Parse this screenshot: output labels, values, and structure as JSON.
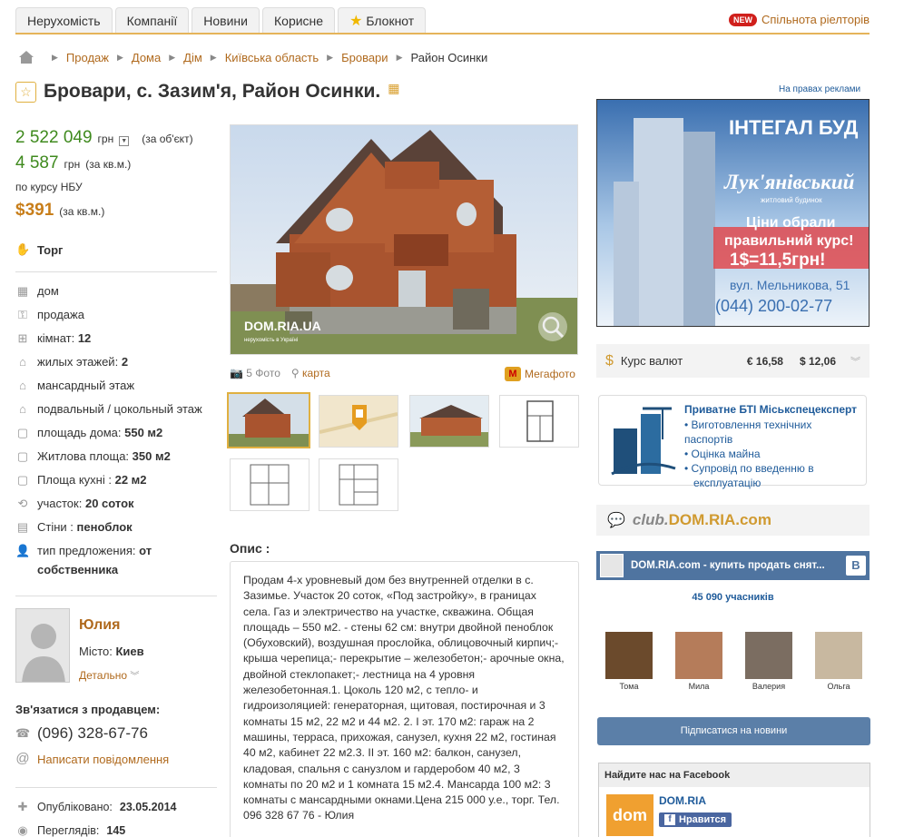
{
  "nav": {
    "tabs": [
      "Нерухомість",
      "Компанії",
      "Новини",
      "Корисне",
      "Блокнот"
    ],
    "new_badge": "NEW",
    "community": "Спільнота ріелторів"
  },
  "breadcrumbs": [
    "Продаж",
    "Дома",
    "Дім",
    "Київська область",
    "Бровари",
    "Район Осинки"
  ],
  "title": "Бровари, с. Зазим'я, Район Осинки.",
  "ad_note": "На правах реклами",
  "price": {
    "total": "2 522 049",
    "total_unit": "грн",
    "total_note": "(за об'єкт)",
    "per_m2": "4 587",
    "per_m2_unit": "грн",
    "per_m2_note": "(за кв.м.)",
    "rate_note": "по курсу НБУ",
    "usd": "$391",
    "usd_note": "(за кв.м.)"
  },
  "bargain": "Торг",
  "params": [
    {
      "icon": "building-icon",
      "label": "дом",
      "value": ""
    },
    {
      "icon": "key-icon",
      "label": "продажа",
      "value": ""
    },
    {
      "icon": "rooms-icon",
      "label": "кімнат:",
      "value": "12"
    },
    {
      "icon": "floors-icon",
      "label": "жилых этажей:",
      "value": "2"
    },
    {
      "icon": "attic-icon",
      "label": "мансардный этаж",
      "value": ""
    },
    {
      "icon": "basement-icon",
      "label": "подвальный / цокольный этаж",
      "value": ""
    },
    {
      "icon": "area-icon",
      "label": "площадь дома:",
      "value": "550 м2"
    },
    {
      "icon": "living-area-icon",
      "label": "Житлова площа:",
      "value": "350 м2"
    },
    {
      "icon": "kitchen-icon",
      "label": "Площа кухні :",
      "value": "22 м2"
    },
    {
      "icon": "plot-icon",
      "label": "участок:",
      "value": "20 соток"
    },
    {
      "icon": "walls-icon",
      "label": "Стіни :",
      "value": "пеноблок"
    },
    {
      "icon": "person-icon",
      "label": "тип предложения:",
      "value": "от собственника"
    }
  ],
  "seller": {
    "name": "Юлия",
    "city_label": "Місто:",
    "city": "Киев",
    "details": "Детально",
    "contact_heading": "Зв'язатися з продавцем:",
    "phone": "(096) 328-67-76",
    "message": "Написати повідомлення",
    "published_label": "Опубліковано:",
    "published": "23.05.2014",
    "views_label": "Переглядів:",
    "views": "145"
  },
  "photo": {
    "watermark": "DOM.RIA.UA",
    "watermark_sub": "нерухомість в Україні",
    "photos_link": "5 Фото",
    "map_link": "карта",
    "megaphoto": "Мегафото"
  },
  "description": {
    "label": "Опис :",
    "text": "Продам 4-х уровневый дом без внутренней отделки в с. Зазимье. Участок 20 соток, «Под застройку», в границах села. Газ и электричество на участке, скважина. Общая площадь – 550 м2. - стены 62 см: внутри двойной пеноблок (Обуховский), воздушная прослойка, облицовочный кирпич;- крыша черепица;- перекрытие – железобетон;- арочные окна, двойной стеклопакет;- лестница на 4 уровня железобетонная.1. Цоколь 120 м2, с тепло- и гидроизоляцией: генераторная, щитовая, постирочная и 3 комнаты 15 м2, 22 м2 и 44 м2. 2. I эт. 170 м2: гараж на 2 машины, терраса, прихожая, санузел, кухня 22 м2, гостиная 40 м2, кабинет 22 м2.3. II эт. 160 м2: балкон, санузел, кладовая, спальня с санузлом и гардеробом 40 м2, 3 комнаты по 20 м2 и 1 комната 15 м2.4. Мансарда 100 м2: 3 комнаты с мансардными окнами.Цена 215 000 у.е., торг. Тел. 096 328 67 76 - Юлия"
  },
  "banner": {
    "brand": "ІНТЕГАЛ БУД",
    "project": "Лук'янівський",
    "project_sub": "житловий будинок",
    "slogan1": "Ціни обрали",
    "slogan2": "правильний курс!",
    "slogan3": "1$=11,5грн!",
    "address": "вул. Мельникова, 51",
    "phone": "(044) 200-02-77"
  },
  "currency": {
    "label": "Курс валют",
    "eur": "€ 16,58",
    "usd": "$ 12,06"
  },
  "bti": {
    "title": "Приватне БТІ Міськспецексперт",
    "items": [
      "Виготовлення технічних паспортів",
      "Оцінка майна",
      "Супровід по введенню в експлуатацію"
    ]
  },
  "club": {
    "prefix": "club.",
    "name": "DOM.RIA.com"
  },
  "vk": {
    "group": "DOM.RIA.com - купить продать снят...",
    "members": "45 090 учасників",
    "people": [
      "Тома",
      "Мила",
      "Валерия",
      "Ольга"
    ],
    "subscribe": "Підписатися на новини"
  },
  "facebook": {
    "heading": "Найдите нас на Facebook",
    "page": "DOM.RIA",
    "like": "Нравится",
    "logo": "dom"
  }
}
